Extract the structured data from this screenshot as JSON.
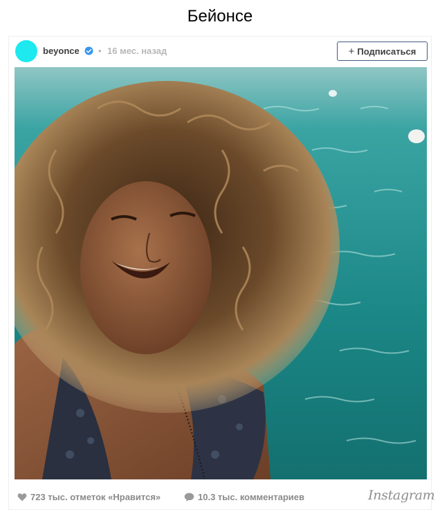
{
  "page": {
    "title": "Бейонсе"
  },
  "post": {
    "username": "beyonce",
    "verified": true,
    "separator": "•",
    "time_ago": "16 мес. назад",
    "follow_label": "Подписаться",
    "avatar_color": "#1de9ef",
    "photo": {
      "subject": "selfie of a woman with curly hair, sea in background",
      "palette": {
        "sea": "#1f8f8c",
        "hair": "#6b4a2a",
        "skin": "#8a5a3c"
      }
    },
    "stats": {
      "likes_text": "723 тыс. отметок «Нравится»",
      "comments_text": "10.3 тыс. комментариев"
    },
    "brand": "Instagram"
  },
  "icons": {
    "verified": "verified-badge-icon",
    "follow": "plus-icon",
    "likes": "heart-icon",
    "comments": "speech-bubble-icon"
  },
  "colors": {
    "verified_blue": "#3897f0",
    "follow_border": "#3d5a80",
    "muted_text": "#8a8a8a"
  }
}
